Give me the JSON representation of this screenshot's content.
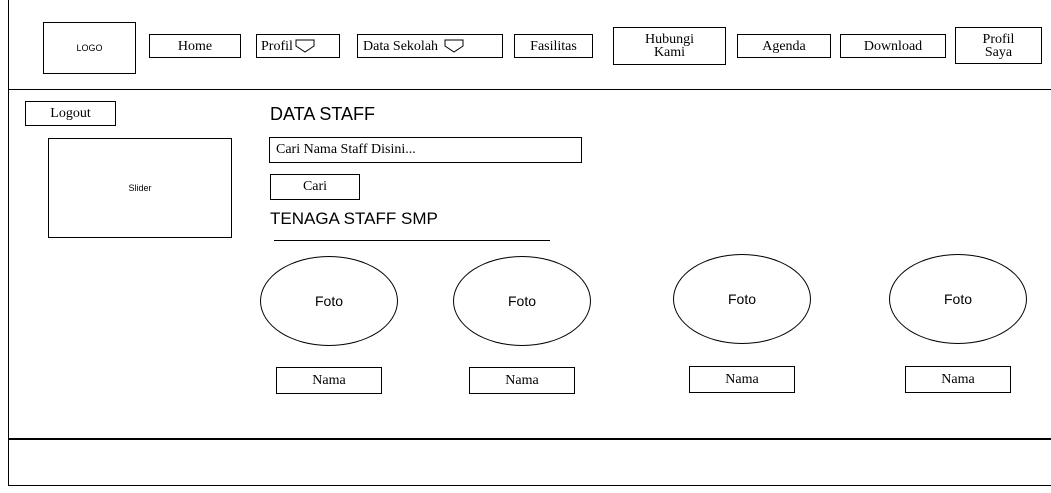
{
  "header": {
    "logo": "LOGO",
    "nav": {
      "home": "Home",
      "profil": "Profil",
      "data_sekolah": "Data Sekolah",
      "fasilitas": "Fasilitas",
      "hubungi_line1": "Hubungi",
      "hubungi_line2": "Kami",
      "agenda": "Agenda",
      "download": "Download",
      "profil_saya_line1": "Profil",
      "profil_saya_line2": "Saya"
    }
  },
  "sidebar": {
    "logout": "Logout",
    "slider": "Slider"
  },
  "main": {
    "title": "DATA STAFF",
    "search_placeholder": "Cari Nama Staff Disini...",
    "search_button": "Cari",
    "section_title": "TENAGA STAFF SMP",
    "staff": [
      {
        "photo": "Foto",
        "name": "Nama"
      },
      {
        "photo": "Foto",
        "name": "Nama"
      },
      {
        "photo": "Foto",
        "name": "Nama"
      },
      {
        "photo": "Foto",
        "name": "Nama"
      }
    ]
  }
}
